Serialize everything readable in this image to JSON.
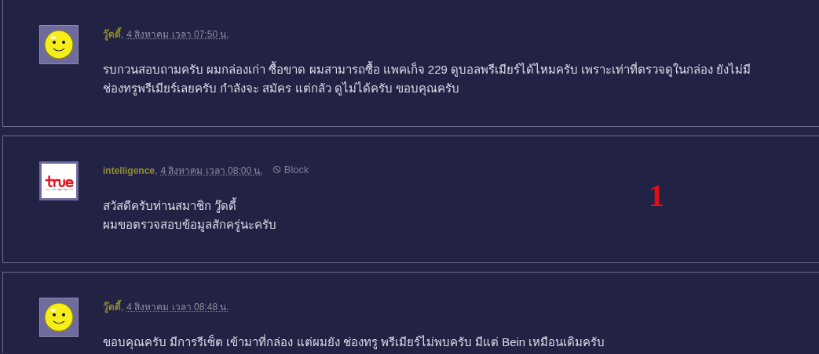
{
  "posts": [
    {
      "author": "วู๊ดดี้",
      "separator": ",",
      "date": "4 สิงหาคม เวลา 07:50 น.",
      "kind": "smiley",
      "body": [
        "รบกวนสอบถามครับ  ผมกล่องเก่า ซื้อขาด ผมสามารถซื้อ แพคเก็จ 229 ดูบอลพรีเมียร์ได้ไหมครับ เพราะเท่าที่ตรวจดูในกล่อง ยังไม่มี ช่องทรูพรีเมียร์เลยครับ กำลังจะ สมัคร แต่กลัว ดูไม่ได้ครับ ขอบคุณครับ"
      ]
    },
    {
      "author": "intelligence",
      "separator": ",",
      "date": "4 สิงหาคม เวลา 08:00 น.",
      "kind": "logo",
      "block": "Block",
      "marker": "1",
      "body": [
        "สวัสดีครับท่านสมาชิก วู๊ดดี้",
        "ผมขอตรวจสอบข้อมูลสักครู่นะครับ"
      ]
    },
    {
      "author": "วู๊ดดี้",
      "separator": ",",
      "date": "4 สิงหาคม เวลา 08:48 น.",
      "kind": "smiley",
      "body": [
        "ขอบคุณครับ มีการรีเซ็ต เข้ามาที่กล่อง แต่ผมยัง ช่องทรู พรีเมียร์ไม่พบครับ มีแต่ Bein เหมือนเดิมครับ"
      ]
    }
  ]
}
